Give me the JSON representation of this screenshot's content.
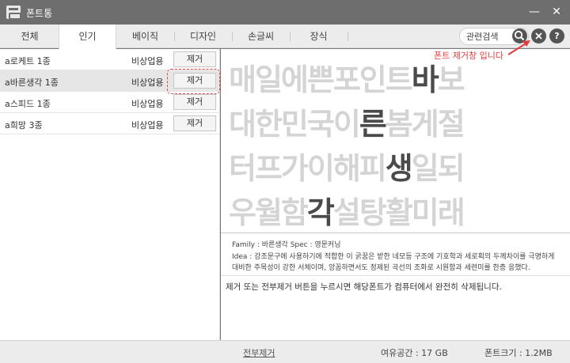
{
  "window": {
    "title": "폰트통",
    "minimize_label": "—",
    "close_label": "✕"
  },
  "tabs": [
    {
      "label": "전체"
    },
    {
      "label": "인기"
    },
    {
      "label": "베이직"
    },
    {
      "label": "디자인"
    },
    {
      "label": "손글씨"
    },
    {
      "label": "장식"
    }
  ],
  "search": {
    "value": "관련검색"
  },
  "buttons": {
    "search_icon": "search-icon",
    "close_icon": "close-icon",
    "help_label": "?"
  },
  "annotation": "폰트 제거창 입니다",
  "font_list": [
    {
      "name": "a로케트 1종",
      "use": "비상업용",
      "action": "제거"
    },
    {
      "name": "a바른생각 1종",
      "use": "비상업용",
      "action": "제거"
    },
    {
      "name": "a스피드 1종",
      "use": "비상업용",
      "action": "제거"
    },
    {
      "name": "a희망 3종",
      "use": "비상업용",
      "action": "제거"
    }
  ],
  "preview": {
    "lines": [
      {
        "before": "매일에쁜포인트",
        "hl": "바",
        "after": "보"
      },
      {
        "before": "대한민국이",
        "hl": "른",
        "after": "봄게절"
      },
      {
        "before": "터프가이해피",
        "hl": "생",
        "after": "일되"
      },
      {
        "before": "우월함",
        "hl": "각",
        "after": "설탕활미래"
      }
    ]
  },
  "info": {
    "line1": "Family : 바른생각   Spec : 영문커닝",
    "line2": "Idea : 강조문구에 사용하기에 적합한 이 굵꿈은 받한 네모등 구조에 기호학과 세로획의 두께차이를 극명하게",
    "line3": "대비한 주목성이 강한 서체이며, 앙꼼하면서도 정제된 곡선의 조화로 시원함과 세련미를 한층 응했다."
  },
  "description": "제거 또는 전부제거 버튼을 누르시면 해당폰트가 컴퓨터에서 완전히 삭제됩니다.",
  "footer": {
    "remove_all": "전부제거",
    "free_space": "여유공간 :  17 GB",
    "font_size": "폰트크기 :  1.2MB"
  }
}
